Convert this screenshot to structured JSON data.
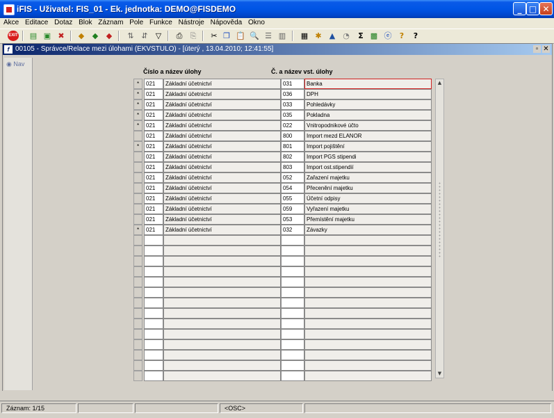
{
  "window": {
    "title": "iFIS - Uživatel: FIS_01 - Ek. jednotka: DEMO@FISDEMO"
  },
  "menu": [
    "Akce",
    "Editace",
    "Dotaz",
    "Blok",
    "Záznam",
    "Pole",
    "Funkce",
    "Nástroje",
    "Nápověda",
    "Okno"
  ],
  "toolbar": {
    "exit_label": "EXIT"
  },
  "form": {
    "title": "00105 - Správce/Relace mezi úlohami (EKVSTULO) - [úterý , 13.04.2010; 12:41:55]",
    "nav_label": "Nav",
    "col1_header": "Číslo a název úlohy",
    "col2_header": "Č. a název vst. úlohy",
    "rows": [
      {
        "flag": "*",
        "code": "021",
        "name": "Základní účetnictví",
        "code2": "031",
        "name2": "Banka"
      },
      {
        "flag": "*",
        "code": "021",
        "name": "Základní účetnictví",
        "code2": "036",
        "name2": "DPH"
      },
      {
        "flag": "*",
        "code": "021",
        "name": "Základní účetnictví",
        "code2": "033",
        "name2": "Pohledávky"
      },
      {
        "flag": "*",
        "code": "021",
        "name": "Základní účetnictví",
        "code2": "035",
        "name2": "Pokladna"
      },
      {
        "flag": "*",
        "code": "021",
        "name": "Základní účetnictví",
        "code2": "022",
        "name2": "Vnitropodnikové účto"
      },
      {
        "flag": "",
        "code": "021",
        "name": "Základní účetnictví",
        "code2": "800",
        "name2": "Import mezd ELANOR"
      },
      {
        "flag": "*",
        "code": "021",
        "name": "Základní účetnictví",
        "code2": "801",
        "name2": "Import pojištění"
      },
      {
        "flag": "",
        "code": "021",
        "name": "Základní účetnictví",
        "code2": "802",
        "name2": "Import PGS stipendi"
      },
      {
        "flag": "",
        "code": "021",
        "name": "Základní účetnictví",
        "code2": "803",
        "name2": "Import ost.stipendií"
      },
      {
        "flag": "",
        "code": "021",
        "name": "Základní účetnictví",
        "code2": "052",
        "name2": "Zařazení majetku"
      },
      {
        "flag": "",
        "code": "021",
        "name": "Základní účetnictví",
        "code2": "054",
        "name2": "Přecenění majetku"
      },
      {
        "flag": "",
        "code": "021",
        "name": "Základní účetnictví",
        "code2": "055",
        "name2": "Účetní odpisy"
      },
      {
        "flag": "",
        "code": "021",
        "name": "Základní účetnictví",
        "code2": "059",
        "name2": "Vyřazení majetku"
      },
      {
        "flag": "",
        "code": "021",
        "name": "Základní účetnictví",
        "code2": "053",
        "name2": "Přemístění majetku"
      },
      {
        "flag": "*",
        "code": "021",
        "name": "Základní účetnictví",
        "code2": "032",
        "name2": "Závazky"
      }
    ],
    "empty_rows": 14
  },
  "status": {
    "record": "Záznam: 1/15",
    "mode": "<OSC>"
  }
}
